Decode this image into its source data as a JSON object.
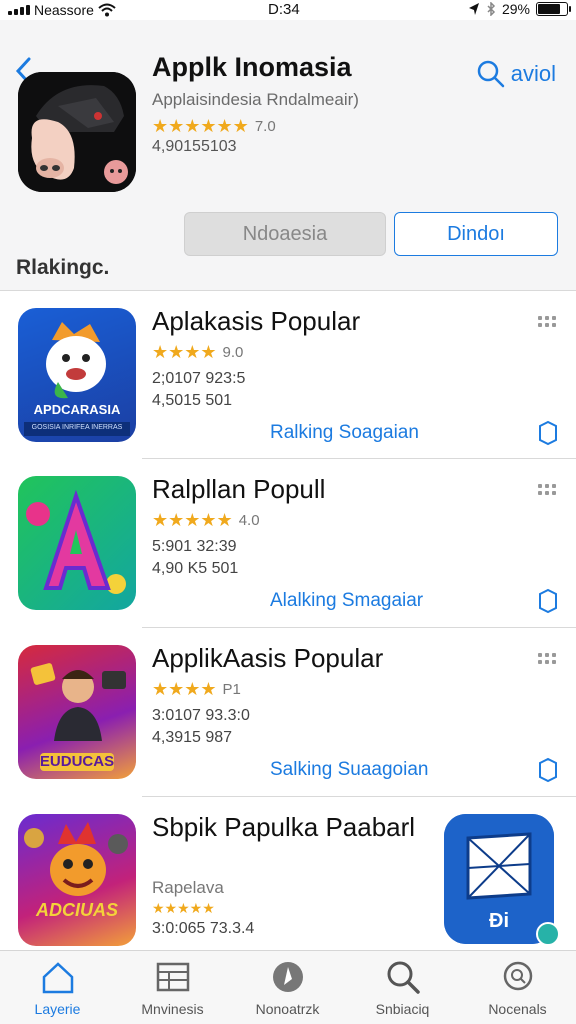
{
  "status_bar": {
    "carrier": "Neassore",
    "time": "D:34",
    "battery": "29%"
  },
  "header": {
    "app_title": "Applk Inomasia",
    "app_subtitle": "Applaisindesia Rndalmeair)",
    "rating_stars": "★★★★★★",
    "rating_value": "7.0",
    "download_count": "4,90155103",
    "search_label": "aviol",
    "button_gray": "Ndoaesia",
    "button_blue": "Dindoı",
    "section_label": "Rlakingc."
  },
  "list": [
    {
      "title": "Aplakasis Popular",
      "stars": "★★★★",
      "rating": "9.0",
      "meta1": "2;0107 923:5",
      "meta2": "4,5015  501",
      "link": "Ralking Soagaian",
      "icon_text": "APDCARASIA",
      "icon_subtext": "GOSISIA INRIFEA INERRAS"
    },
    {
      "title": "Ralpllan Popull",
      "stars": "★★★★★",
      "rating": "4.0",
      "meta1": "5:901 32:39",
      "meta2": "4,90 K5 501",
      "link": "Alalking Smagaiar",
      "icon_text": "A"
    },
    {
      "title": "ApplikAasis Popular",
      "stars": "★★★★",
      "rating": "P1",
      "meta1": "3:0107 93.3:0",
      "meta2": "4,3915  987",
      "link": "Salking Suaagoian",
      "icon_text": "EUDUCAS"
    },
    {
      "title": "Sbpik Papulka Paabarl",
      "subtitle": "Rapelava",
      "stars": "★★★★★",
      "meta": "3:0:065 73.3.4",
      "icon_text": "ADCIUAS"
    }
  ],
  "floating_icon": {
    "label": "Đi"
  },
  "tab_bar": {
    "items": [
      {
        "label": "Layerie"
      },
      {
        "label": "Mnvinesis"
      },
      {
        "label": "Nonoatrzk"
      },
      {
        "label": "Snbiaciq"
      },
      {
        "label": "Nocenals"
      }
    ]
  },
  "colors": {
    "accent": "#1c7be0",
    "star": "#f0a91d",
    "header_bg": "#f5f5f6"
  }
}
